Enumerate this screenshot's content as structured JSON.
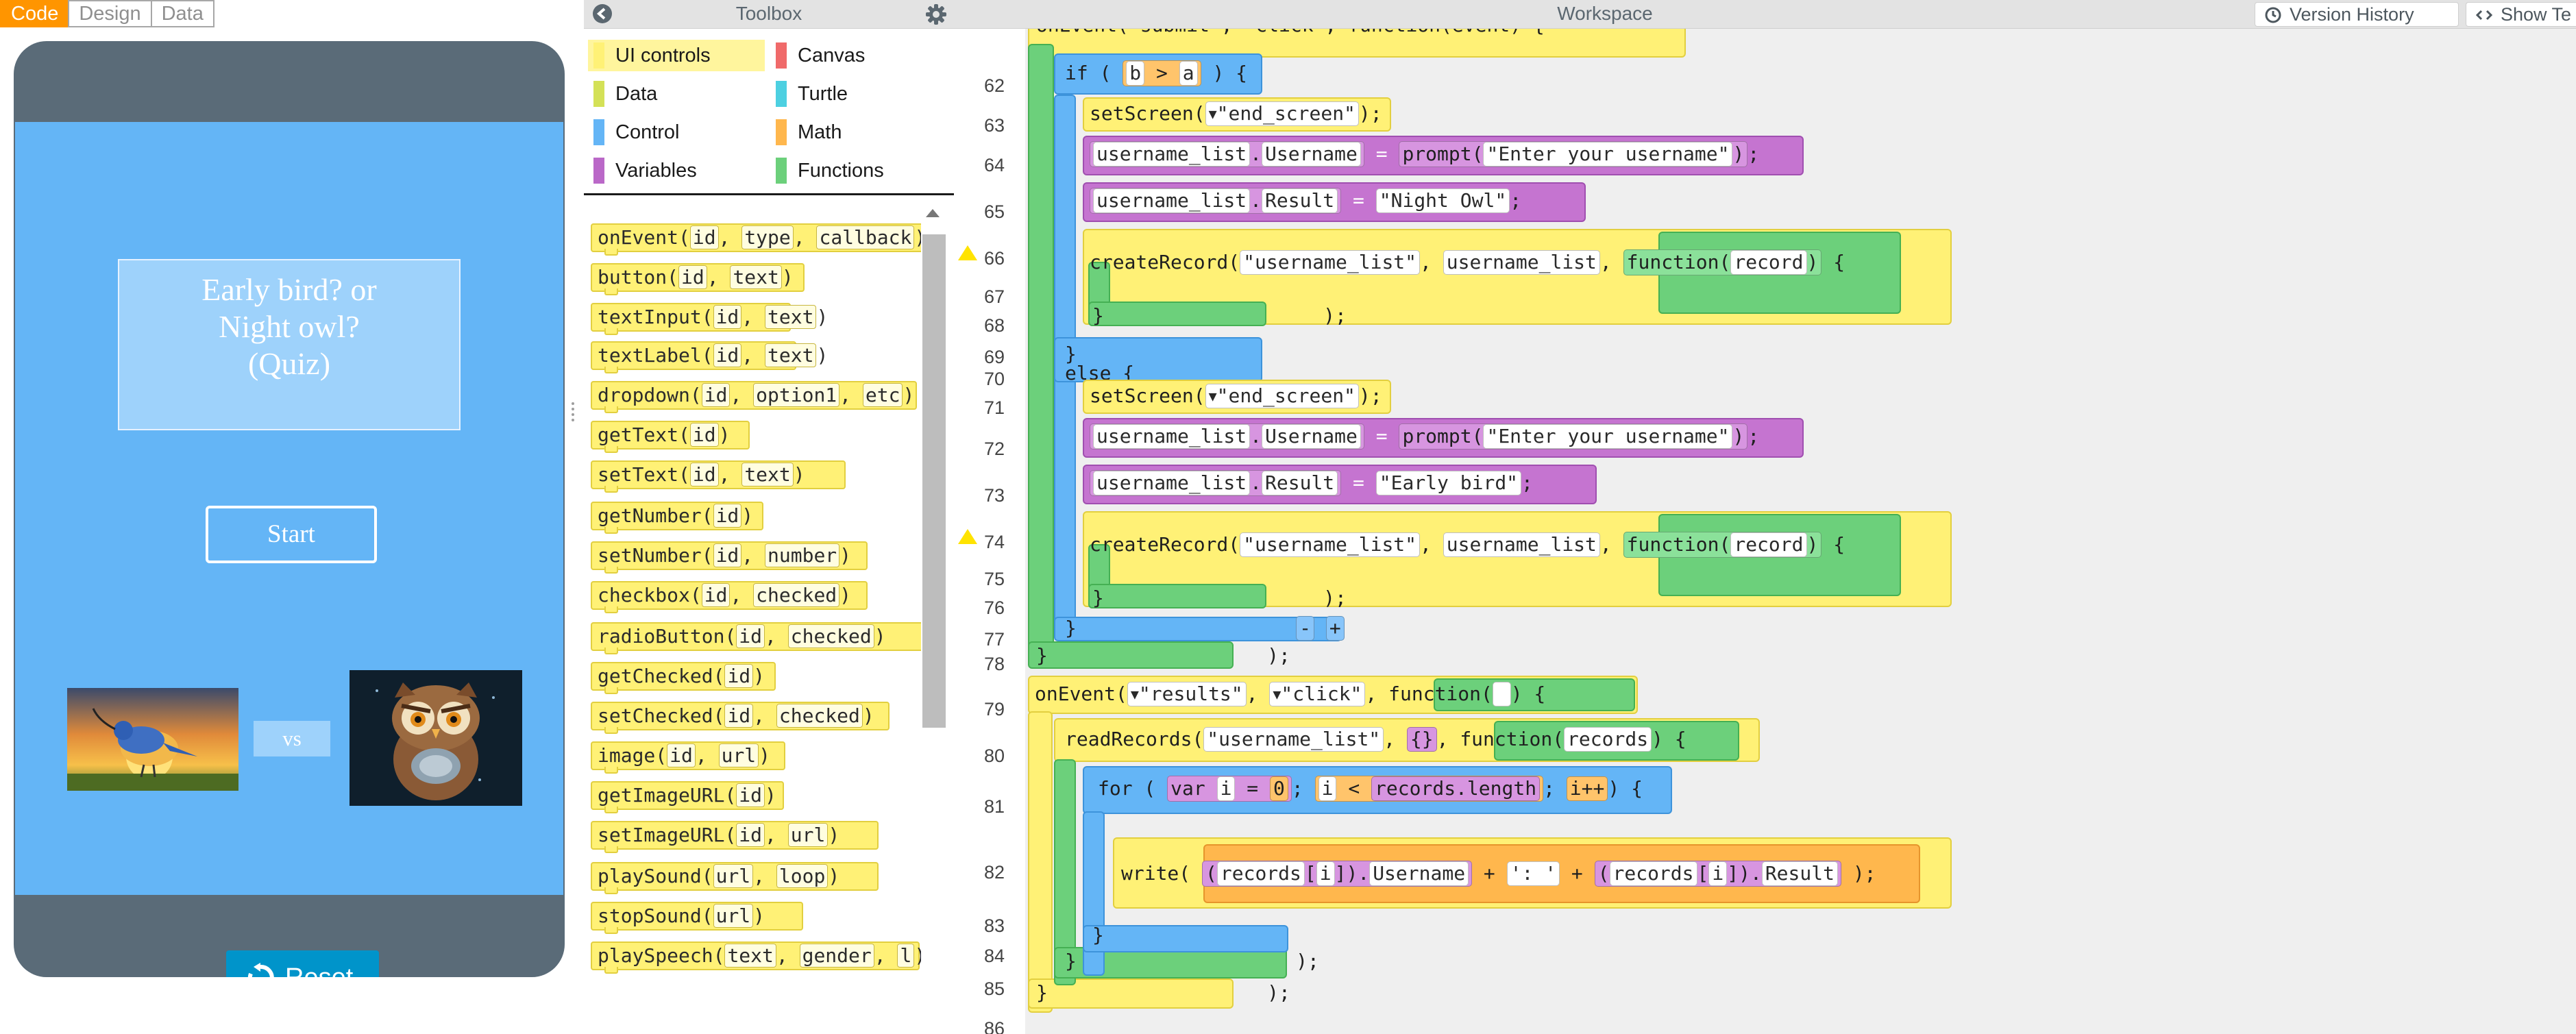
{
  "mode_tabs": [
    "Code",
    "Design",
    "Data"
  ],
  "app": {
    "title_lines": [
      "Early bird? or",
      "Night owl?",
      "(Quiz)"
    ],
    "start_label": "Start",
    "vs_label": "vs",
    "reset_label": "Reset"
  },
  "toolbox": {
    "title": "Toolbox",
    "categories": [
      {
        "label": "UI controls",
        "color": "#fff176"
      },
      {
        "label": "Canvas",
        "color": "#f06a6a"
      },
      {
        "label": "Data",
        "color": "#d4e157"
      },
      {
        "label": "Turtle",
        "color": "#4dd0e1"
      },
      {
        "label": "Control",
        "color": "#64b5f6"
      },
      {
        "label": "Math",
        "color": "#ffb74d"
      },
      {
        "label": "Variables",
        "color": "#ba68c8"
      },
      {
        "label": "Functions",
        "color": "#6cd07b"
      }
    ],
    "blocks": [
      [
        "onEvent",
        "id",
        "type",
        "callback"
      ],
      [
        "button",
        "id",
        "text"
      ],
      [
        "textInput",
        "id",
        "text"
      ],
      [
        "textLabel",
        "id",
        "text"
      ],
      [
        "dropdown",
        "id",
        "option1",
        "etc"
      ],
      [
        "getText",
        "id"
      ],
      [
        "setText",
        "id",
        "text"
      ],
      [
        "getNumber",
        "id"
      ],
      [
        "setNumber",
        "id",
        "number"
      ],
      [
        "checkbox",
        "id",
        "checked"
      ],
      [
        "radioButton",
        "id",
        "checked"
      ],
      [
        "getChecked",
        "id"
      ],
      [
        "setChecked",
        "id",
        "checked"
      ],
      [
        "image",
        "id",
        "url"
      ],
      [
        "getImageURL",
        "id"
      ],
      [
        "setImageURL",
        "id",
        "url"
      ],
      [
        "playSound",
        "url",
        "loop"
      ],
      [
        "stopSound",
        "url"
      ],
      [
        "playSpeech",
        "text",
        "gender",
        "l"
      ]
    ]
  },
  "workspace": {
    "title": "Workspace",
    "version_history_label": "Version History",
    "show_text_label": "Show Te",
    "line_numbers": [
      "62",
      "63",
      "64",
      "65",
      "66",
      "67",
      "68",
      "69",
      "70",
      "71",
      "72",
      "73",
      "74",
      "75",
      "76",
      "77",
      "78",
      "79",
      "80",
      "81",
      "82",
      "83",
      "84",
      "85",
      "86"
    ],
    "code": {
      "if_kw": "if",
      "b": "b",
      "gt": ">",
      "a": "a",
      "setScreen": "setScreen",
      "end_screen": "\"end_screen\"",
      "username_list": "username_list",
      "Username": "Username",
      "Result": "Result",
      "prompt": "prompt",
      "enter_username": "\"Enter your username\"",
      "night_owl": "\"Night Owl\"",
      "early_bird": "\"Early bird\"",
      "createRecord": "createRecord",
      "table_name": "\"username_list\"",
      "function_kw": "function",
      "record": "record",
      "records": "records",
      "else_kw": "else",
      "onEvent": "onEvent",
      "results_id": "\"results\"",
      "click": "\"click\"",
      "readRecords": "readRecords",
      "empty_obj": "{}",
      "for_kw": "for",
      "var_kw": "var",
      "i": "i",
      "zero": "0",
      "lt": "<",
      "length": "records.length",
      "incr": "i++",
      "write": "write",
      "colon_str": "': '",
      "plus": "+",
      "partial_top": "onEvent(\"submit\", \"click\", function(event) {"
    }
  }
}
